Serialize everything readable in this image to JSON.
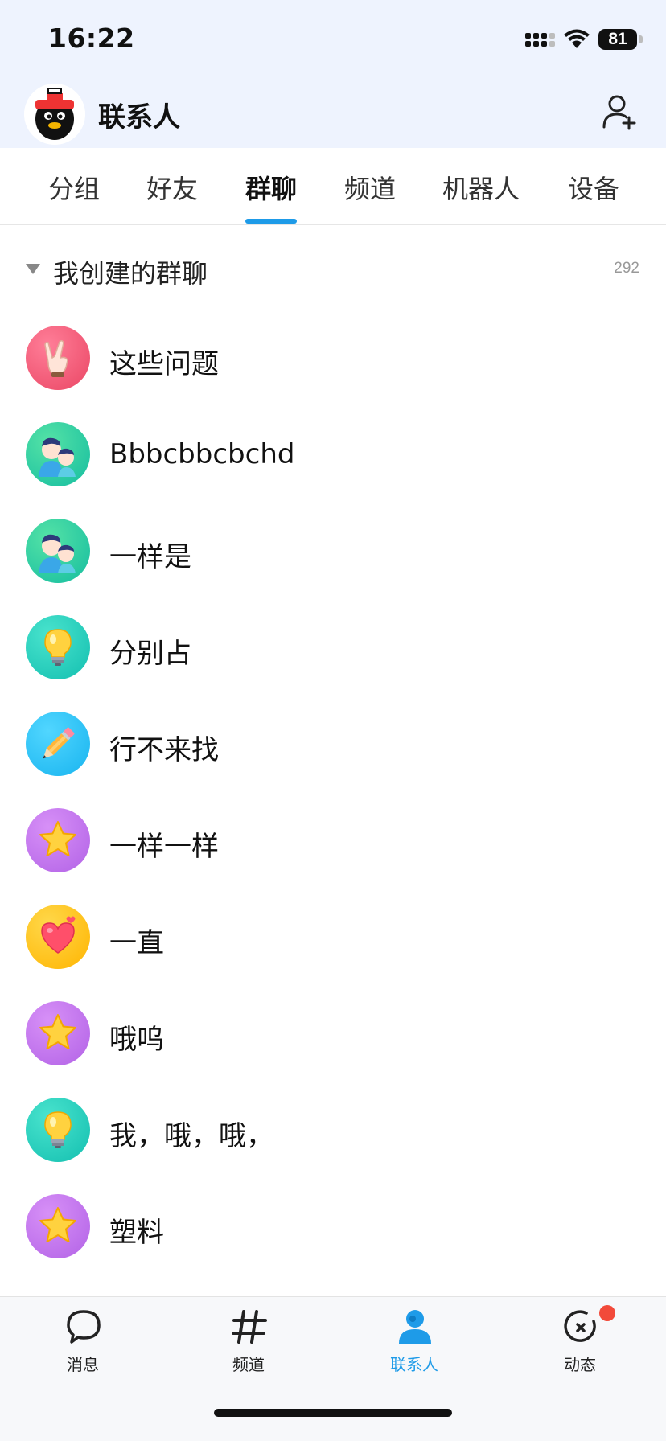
{
  "status_bar": {
    "time": "16:22",
    "battery": "81"
  },
  "header": {
    "title": "联系人",
    "add_icon": "add-person-icon"
  },
  "tabs": [
    {
      "label": "分组",
      "active": false
    },
    {
      "label": "好友",
      "active": false
    },
    {
      "label": "群聊",
      "active": true
    },
    {
      "label": "频道",
      "active": false
    },
    {
      "label": "机器人",
      "active": false
    },
    {
      "label": "设备",
      "active": false
    }
  ],
  "section": {
    "title": "我创建的群聊",
    "count": "292",
    "expanded": true
  },
  "groups": [
    {
      "name": "这些问题",
      "icon": "rock-hand-icon",
      "color": "#ea4664"
    },
    {
      "name": "Bbbcbbcbchd",
      "icon": "two-people-icon",
      "color": "#15bda0"
    },
    {
      "name": "一样是",
      "icon": "two-people-icon",
      "color": "#15bda0"
    },
    {
      "name": "分别占",
      "icon": "lightbulb-icon",
      "color": "#13bfb0"
    },
    {
      "name": "行不来找",
      "icon": "pencil-icon",
      "color": "#18b4ef"
    },
    {
      "name": "一样一样",
      "icon": "star-icon",
      "color": "#b262e6"
    },
    {
      "name": "一直",
      "icon": "heart-icon",
      "color": "#ffb400"
    },
    {
      "name": "哦呜",
      "icon": "star-icon",
      "color": "#b262e6"
    },
    {
      "name": "我，哦，哦，",
      "icon": "lightbulb-icon",
      "color": "#13bfb0"
    },
    {
      "name": "塑料",
      "icon": "star-icon",
      "color": "#b262e6"
    }
  ],
  "bottom_nav": [
    {
      "label": "消息",
      "icon": "chat-bubble-icon",
      "active": false
    },
    {
      "label": "频道",
      "icon": "hashtag-icon",
      "active": false
    },
    {
      "label": "联系人",
      "icon": "contacts-icon",
      "active": true
    },
    {
      "label": "动态",
      "icon": "activity-icon",
      "active": false,
      "badge": true
    }
  ],
  "colors": {
    "accent": "#1e9be8",
    "header_bg": "#eef3fe",
    "badge": "#f24a3a"
  }
}
